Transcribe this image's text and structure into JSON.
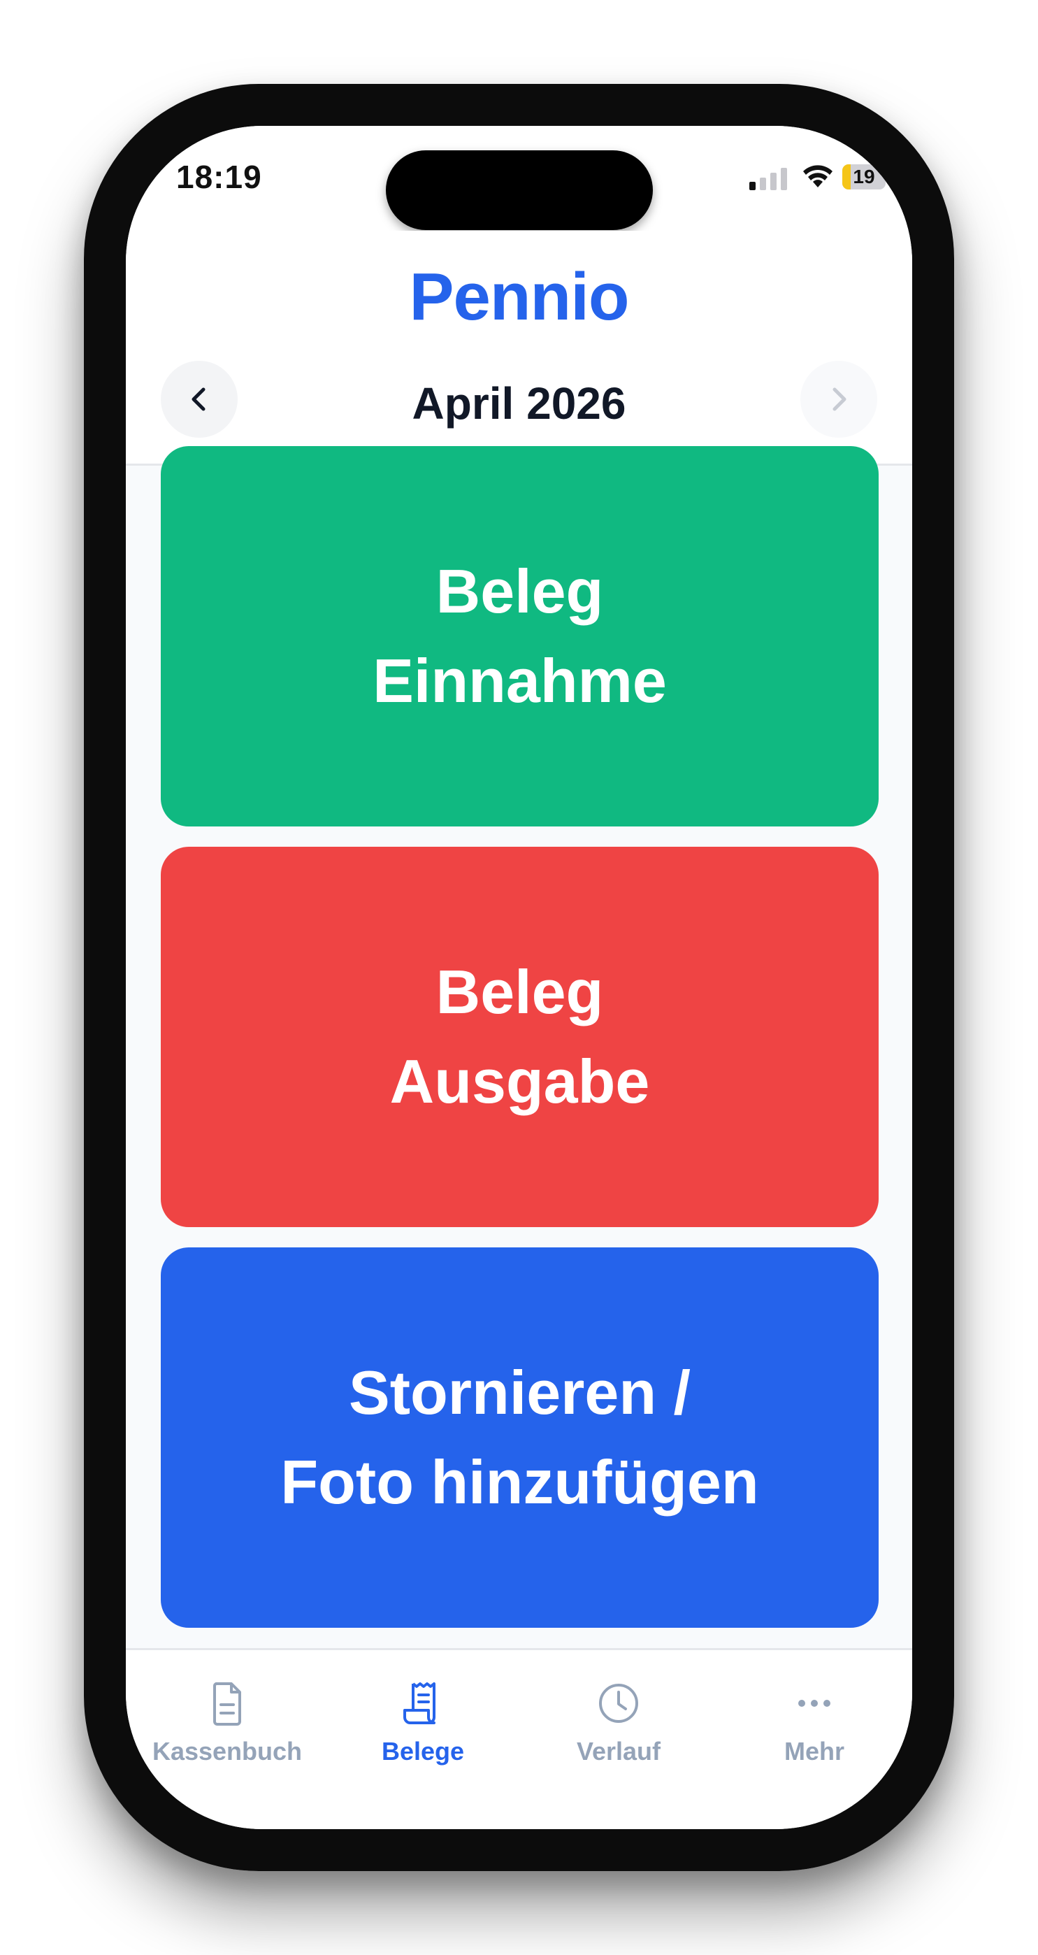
{
  "status_bar": {
    "time": "18:19",
    "battery_level": "19",
    "battery_fraction": 0.19,
    "signal_bars_active": 1,
    "signal_bars_total": 4
  },
  "header": {
    "app_title": "Pennio",
    "month_label": "April 2026",
    "prev_icon": "chevron-left-icon",
    "next_icon": "chevron-right-icon"
  },
  "actions": {
    "income": {
      "line1": "Beleg",
      "line2": "Einnahme",
      "color": "#10b981"
    },
    "expense": {
      "line1": "Beleg",
      "line2": "Ausgabe",
      "color": "#ef4444"
    },
    "cancel": {
      "line1": "Stornieren /",
      "line2": "Foto hinzufügen",
      "color": "#2563eb"
    }
  },
  "tab_bar": {
    "tabs": [
      {
        "label": "Kassenbuch",
        "icon": "document-icon",
        "active": false
      },
      {
        "label": "Belege",
        "icon": "receipt-icon",
        "active": true
      },
      {
        "label": "Verlauf",
        "icon": "clock-icon",
        "active": false
      },
      {
        "label": "Mehr",
        "icon": "more-icon",
        "active": false
      }
    ]
  },
  "colors": {
    "accent": "#2563eb",
    "inactive_tab": "#94a3b8",
    "income": "#10b981",
    "expense": "#ef4444"
  }
}
